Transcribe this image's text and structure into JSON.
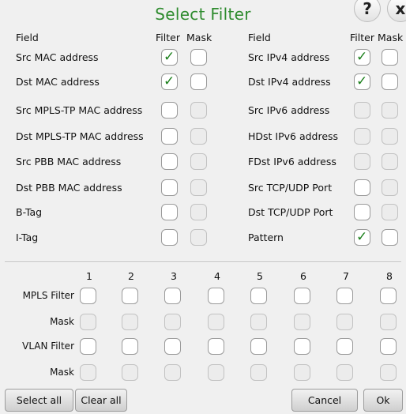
{
  "title": "Select Filter",
  "header_buttons": {
    "help_label": "?",
    "close_label": "x"
  },
  "columns": {
    "field": "Field",
    "filter": "Filter",
    "mask": "Mask"
  },
  "fields_left": [
    {
      "label": "Src MAC address",
      "filter": true,
      "mask": false,
      "filter_enabled": true,
      "mask_enabled": true
    },
    {
      "label": "Dst MAC address",
      "filter": true,
      "mask": false,
      "filter_enabled": true,
      "mask_enabled": true
    },
    {
      "label": "Src MPLS-TP MAC address",
      "filter": false,
      "mask": false,
      "filter_enabled": true,
      "mask_enabled": false
    },
    {
      "label": "Dst MPLS-TP MAC address",
      "filter": false,
      "mask": false,
      "filter_enabled": true,
      "mask_enabled": false
    },
    {
      "label": "Src PBB MAC address",
      "filter": false,
      "mask": false,
      "filter_enabled": true,
      "mask_enabled": false
    },
    {
      "label": "Dst PBB MAC address",
      "filter": false,
      "mask": false,
      "filter_enabled": true,
      "mask_enabled": false
    },
    {
      "label": "B-Tag",
      "filter": false,
      "mask": false,
      "filter_enabled": true,
      "mask_enabled": false
    },
    {
      "label": "I-Tag",
      "filter": false,
      "mask": false,
      "filter_enabled": true,
      "mask_enabled": false
    }
  ],
  "fields_right": [
    {
      "label": "Src IPv4 address",
      "filter": true,
      "mask": false,
      "filter_enabled": true,
      "mask_enabled": true
    },
    {
      "label": "Dst IPv4 address",
      "filter": true,
      "mask": false,
      "filter_enabled": true,
      "mask_enabled": true
    },
    {
      "label": "Src IPv6 address",
      "filter": false,
      "mask": false,
      "filter_enabled": false,
      "mask_enabled": false
    },
    {
      "label": "HDst IPv6 address",
      "filter": false,
      "mask": false,
      "filter_enabled": false,
      "mask_enabled": false
    },
    {
      "label": "FDst IPv6 address",
      "filter": false,
      "mask": false,
      "filter_enabled": false,
      "mask_enabled": false
    },
    {
      "label": "Src TCP/UDP Port",
      "filter": false,
      "mask": false,
      "filter_enabled": true,
      "mask_enabled": false
    },
    {
      "label": "Dst TCP/UDP Port",
      "filter": false,
      "mask": false,
      "filter_enabled": true,
      "mask_enabled": false
    },
    {
      "label": "Pattern",
      "filter": true,
      "mask": false,
      "filter_enabled": true,
      "mask_enabled": true
    }
  ],
  "grid": {
    "columns": [
      "1",
      "2",
      "3",
      "4",
      "5",
      "6",
      "7",
      "8"
    ],
    "rows": [
      {
        "label": "MPLS Filter",
        "enabled": true
      },
      {
        "label": "Mask",
        "enabled": false
      },
      {
        "label": "VLAN Filter",
        "enabled": true
      },
      {
        "label": "Mask",
        "enabled": false
      }
    ]
  },
  "buttons": {
    "select_all": "Select all",
    "clear_all": "Clear all",
    "cancel": "Cancel",
    "ok": "Ok"
  },
  "check_mark": "✓",
  "colors": {
    "title": "#2e8b2e",
    "check": "#1a7f1a"
  }
}
